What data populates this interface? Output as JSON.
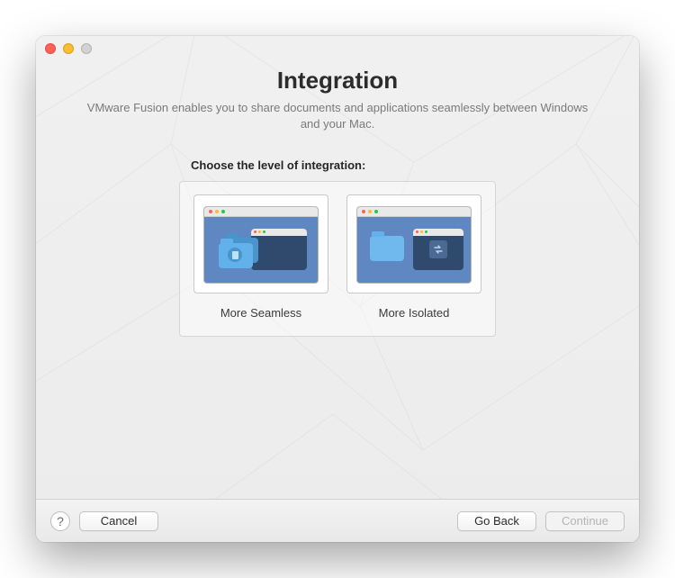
{
  "header": {
    "title": "Integration",
    "subtitle": "VMware Fusion enables you to share documents and applications seamlessly between Windows and your Mac."
  },
  "section": {
    "label": "Choose the level of integration:"
  },
  "options": {
    "seamless": {
      "label": "More Seamless"
    },
    "isolated": {
      "label": "More Isolated"
    }
  },
  "footer": {
    "help": "?",
    "cancel": "Cancel",
    "goback": "Go Back",
    "continue": "Continue"
  }
}
